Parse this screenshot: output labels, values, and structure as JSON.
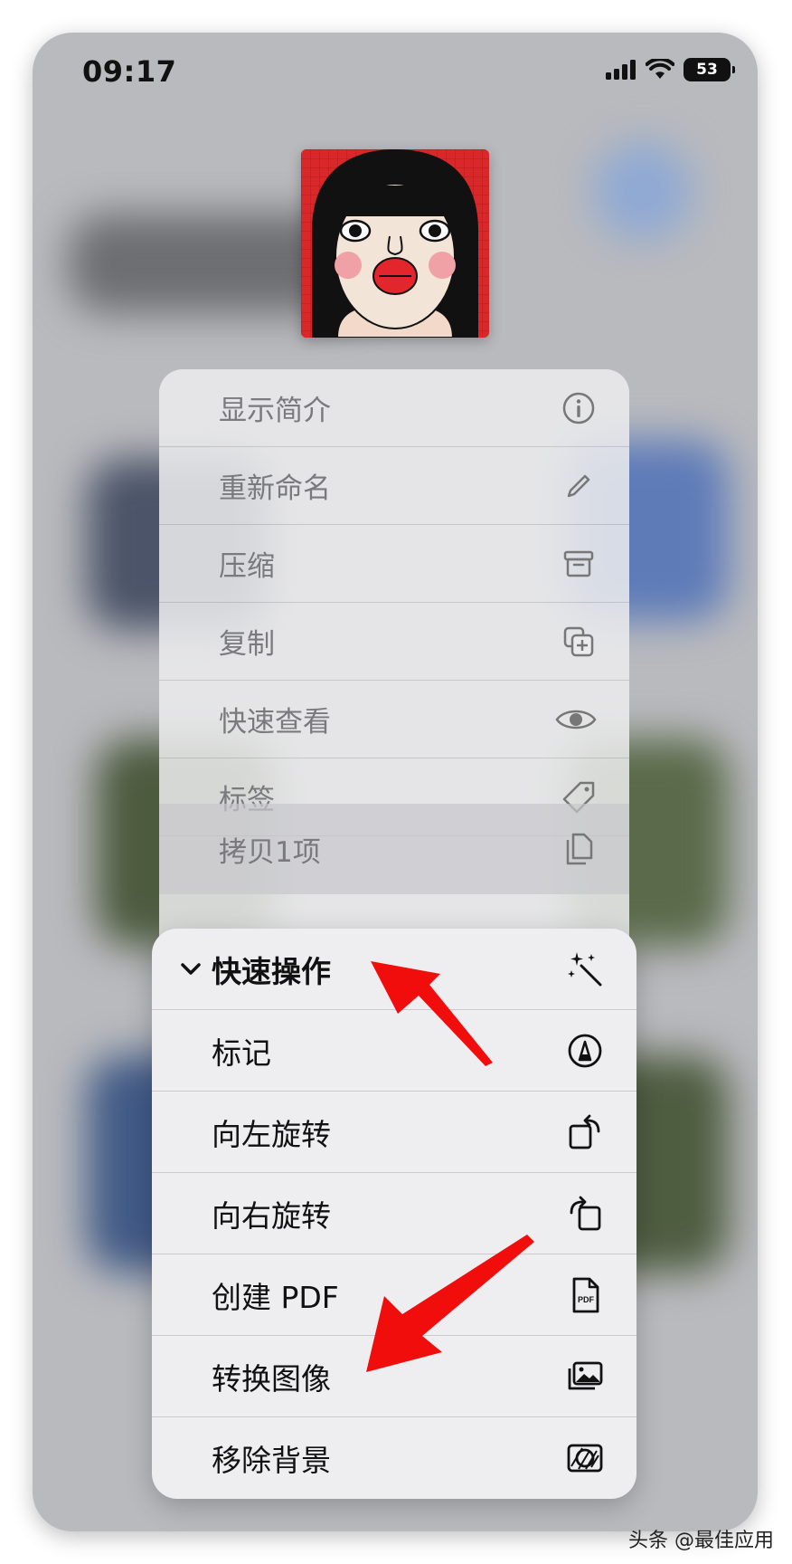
{
  "status_bar": {
    "time": "09:17",
    "battery": "53"
  },
  "context_menu_top": {
    "items": [
      {
        "label": "显示简介",
        "icon": "info-icon"
      },
      {
        "label": "重新命名",
        "icon": "pencil-icon"
      },
      {
        "label": "压缩",
        "icon": "archive-box-icon"
      },
      {
        "label": "复制",
        "icon": "duplicate-icon"
      },
      {
        "label": "快速查看",
        "icon": "eye-icon"
      },
      {
        "label": "标签",
        "icon": "tag-icon"
      }
    ],
    "copy_item": {
      "label": "拷贝1项",
      "icon": "copy-docs-icon"
    }
  },
  "quick_actions_menu": {
    "header": {
      "label": "快速操作",
      "icon": "magic-wand-icon"
    },
    "items": [
      {
        "label": "标记",
        "icon": "markup-icon"
      },
      {
        "label": "向左旋转",
        "icon": "rotate-left-icon"
      },
      {
        "label": "向右旋转",
        "icon": "rotate-right-icon"
      },
      {
        "label": "创建 PDF",
        "icon": "pdf-icon",
        "icon_text": "PDF"
      },
      {
        "label": "转换图像",
        "icon": "photos-icon"
      },
      {
        "label": "移除背景",
        "icon": "remove-background-icon"
      }
    ]
  },
  "watermark": "头条 @最佳应用",
  "colors": {
    "arrow_red": "#f20d0d",
    "menu_bg": "#eeeef0",
    "thumbnail_red": "#d8282a"
  }
}
